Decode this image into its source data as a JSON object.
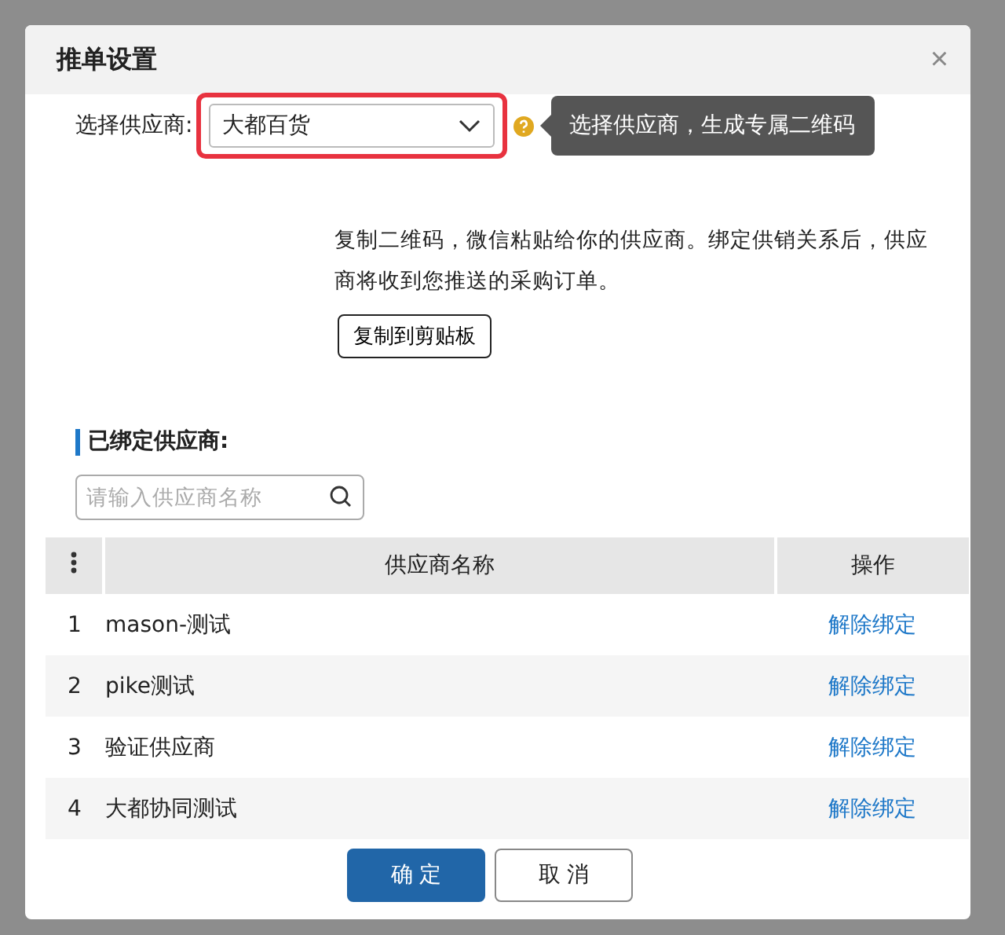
{
  "dialog": {
    "title": "推单设置",
    "close": "×"
  },
  "supplier_select": {
    "label": "选择供应商:",
    "value": "大都百货",
    "highlighted": true
  },
  "tooltip": {
    "text": "选择供应商，生成专属二维码"
  },
  "instructions": "复制二维码，微信粘贴给你的供应商。绑定供销关系后，供应商将收到您推送的采购订单。",
  "copy_button": "复制到剪贴板",
  "bound_section": {
    "title": "已绑定供应商:",
    "search": {
      "placeholder": "请输入供应商名称"
    }
  },
  "table": {
    "columns": [
      "供应商名称",
      "操作"
    ],
    "rows": [
      {
        "index": "1",
        "name": "mason-测试",
        "action": "解除绑定"
      },
      {
        "index": "2",
        "name": "pike测试",
        "action": "解除绑定"
      },
      {
        "index": "3",
        "name": "验证供应商",
        "action": "解除绑定"
      },
      {
        "index": "4",
        "name": "大都协同测试",
        "action": "解除绑定"
      }
    ]
  },
  "buttons": [
    {
      "label": "确 定",
      "kind": "primary"
    },
    {
      "label": "取 消",
      "kind": "secondary"
    }
  ]
}
